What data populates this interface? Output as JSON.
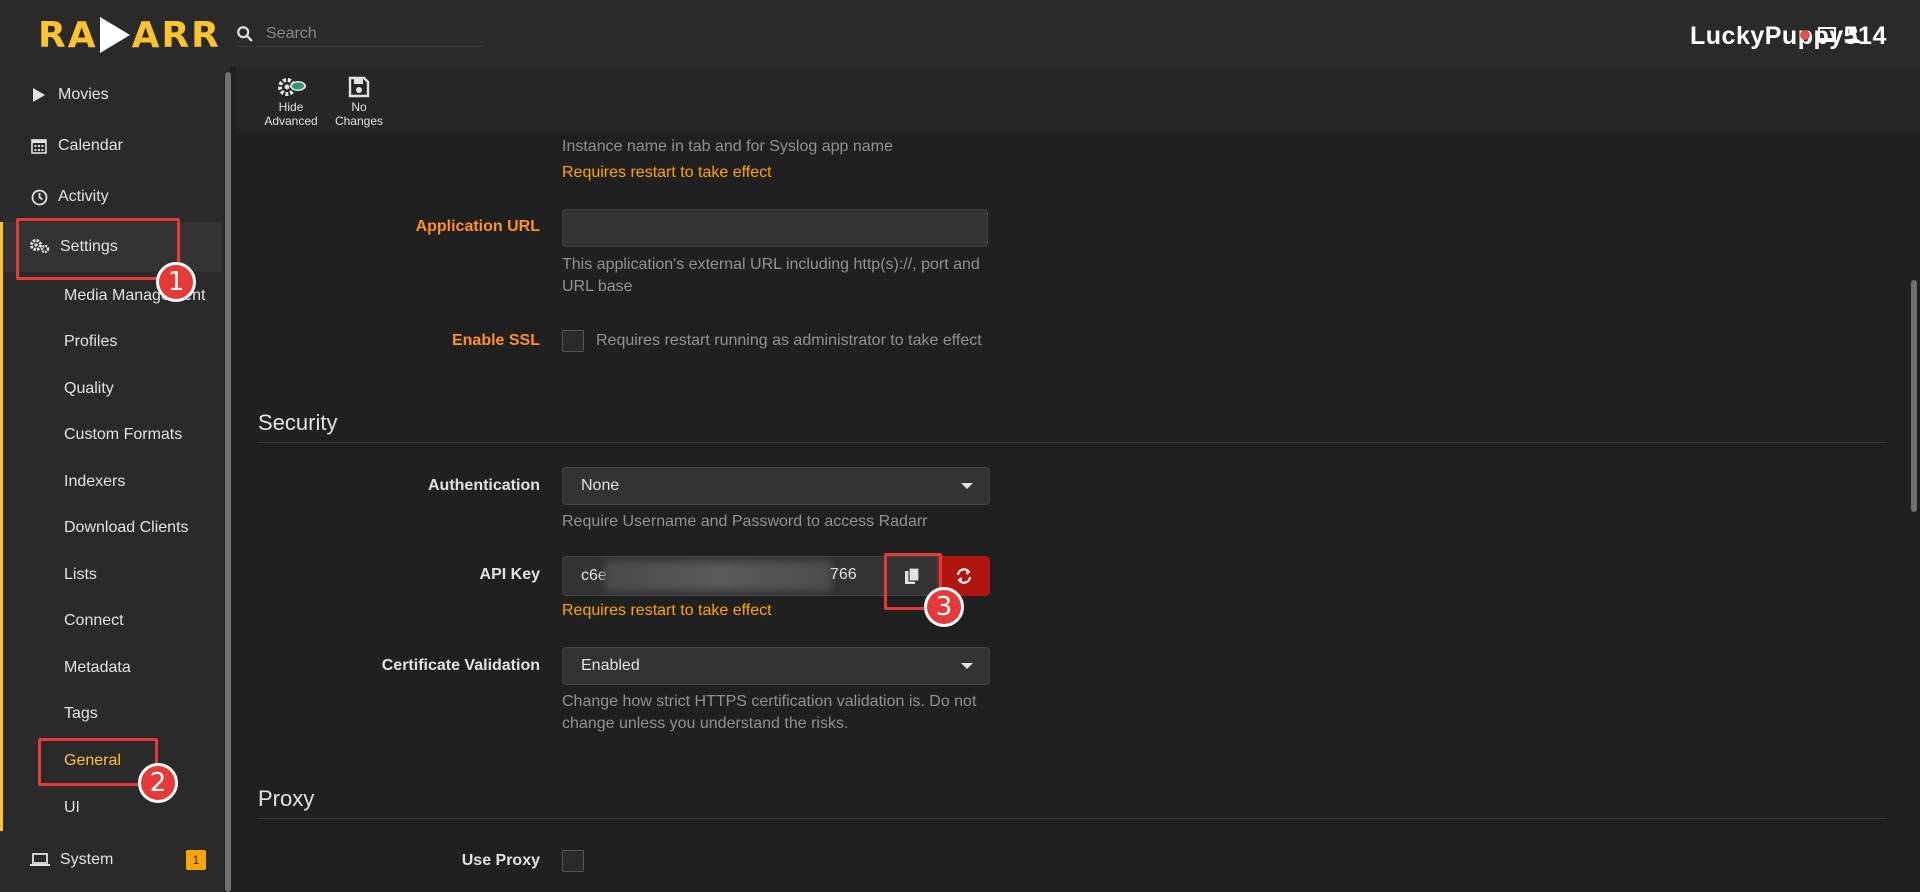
{
  "app": {
    "logo_left": "RA",
    "logo_right": "ARR"
  },
  "header": {
    "search_placeholder": "Search",
    "username": "LuckyPuppy514"
  },
  "sidebar": {
    "top_items": [
      {
        "label": "Movies",
        "icon": "play-icon"
      },
      {
        "label": "Calendar",
        "icon": "calendar-icon"
      },
      {
        "label": "Activity",
        "icon": "clock-icon"
      }
    ],
    "settings": {
      "label": "Settings",
      "items": [
        {
          "label": "Media Management"
        },
        {
          "label": "Profiles"
        },
        {
          "label": "Quality"
        },
        {
          "label": "Custom Formats"
        },
        {
          "label": "Indexers"
        },
        {
          "label": "Download Clients"
        },
        {
          "label": "Lists"
        },
        {
          "label": "Connect"
        },
        {
          "label": "Metadata"
        },
        {
          "label": "Tags"
        },
        {
          "label": "General",
          "active": true
        },
        {
          "label": "UI"
        }
      ]
    },
    "system": {
      "label": "System",
      "badge": "1"
    }
  },
  "toolbar": {
    "advanced_line1": "Hide",
    "advanced_line2": "Advanced",
    "save_line1": "No",
    "save_line2": "Changes"
  },
  "general": {
    "instance_help": "Instance name in tab and for Syslog app name",
    "instance_warning": "Requires restart to take effect",
    "app_url_label": "Application URL",
    "app_url_value": "",
    "app_url_help_1": "This application's external URL including http(s)://, port and",
    "app_url_help_2": "URL base",
    "ssl_label": "Enable SSL",
    "ssl_help": "Requires restart running as administrator to take effect"
  },
  "security": {
    "title": "Security",
    "auth_label": "Authentication",
    "auth_value": "None",
    "auth_help": "Require Username and Password to access Radarr",
    "api_label": "API Key",
    "api_prefix": "c6e",
    "api_suffix": "766",
    "api_warning": "Requires restart to take effect",
    "cert_label": "Certificate Validation",
    "cert_value": "Enabled",
    "cert_help_1": "Change how strict HTTPS certification validation is. Do not",
    "cert_help_2": "change unless you understand the risks."
  },
  "proxy": {
    "title": "Proxy",
    "use_proxy_label": "Use Proxy"
  },
  "annotations": [
    "1",
    "2",
    "3"
  ],
  "colors": {
    "accent": "#ffc230",
    "advanced_label": "#ff902b",
    "warning": "#ffa500",
    "danger": "#b0150f",
    "annotation": "#e53a3a"
  }
}
